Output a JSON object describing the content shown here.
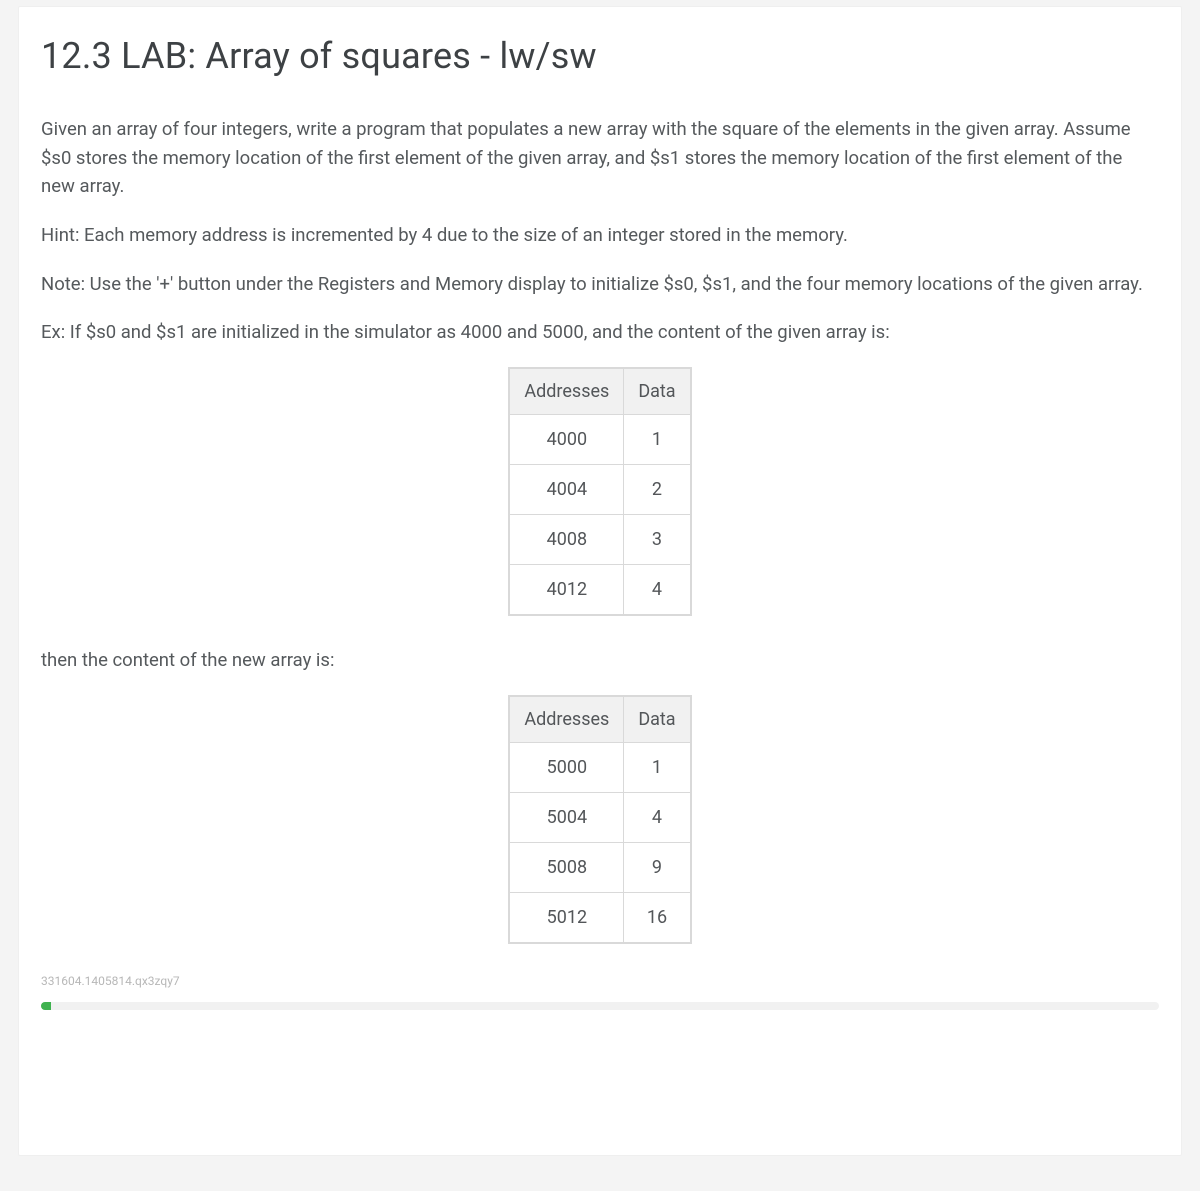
{
  "heading": "12.3 LAB: Array of squares - lw/sw",
  "paragraphs": {
    "p1": "Given an array of four integers, write a program that populates a new array with the square of the elements in the given array. Assume $s0 stores the memory location of the first element of the given array, and $s1 stores the memory location of the first element of the new array.",
    "p2": "Hint: Each memory address is incremented by 4 due to the size of an integer stored in the memory.",
    "p3": "Note: Use the '+' button under the Registers and Memory display to initialize $s0, $s1, and the four memory locations of the given array.",
    "p4": "Ex: If $s0 and $s1 are initialized in the simulator as 4000 and 5000, and the content of the given array is:",
    "p5": "then the content of the new array is:"
  },
  "tableHeaders": {
    "addresses": "Addresses",
    "data": "Data"
  },
  "table1": [
    {
      "addr": "4000",
      "data": "1"
    },
    {
      "addr": "4004",
      "data": "2"
    },
    {
      "addr": "4008",
      "data": "3"
    },
    {
      "addr": "4012",
      "data": "4"
    }
  ],
  "table2": [
    {
      "addr": "5000",
      "data": "1"
    },
    {
      "addr": "5004",
      "data": "4"
    },
    {
      "addr": "5008",
      "data": "9"
    },
    {
      "addr": "5012",
      "data": "16"
    }
  ],
  "footerId": "331604.1405814.qx3zqy7"
}
